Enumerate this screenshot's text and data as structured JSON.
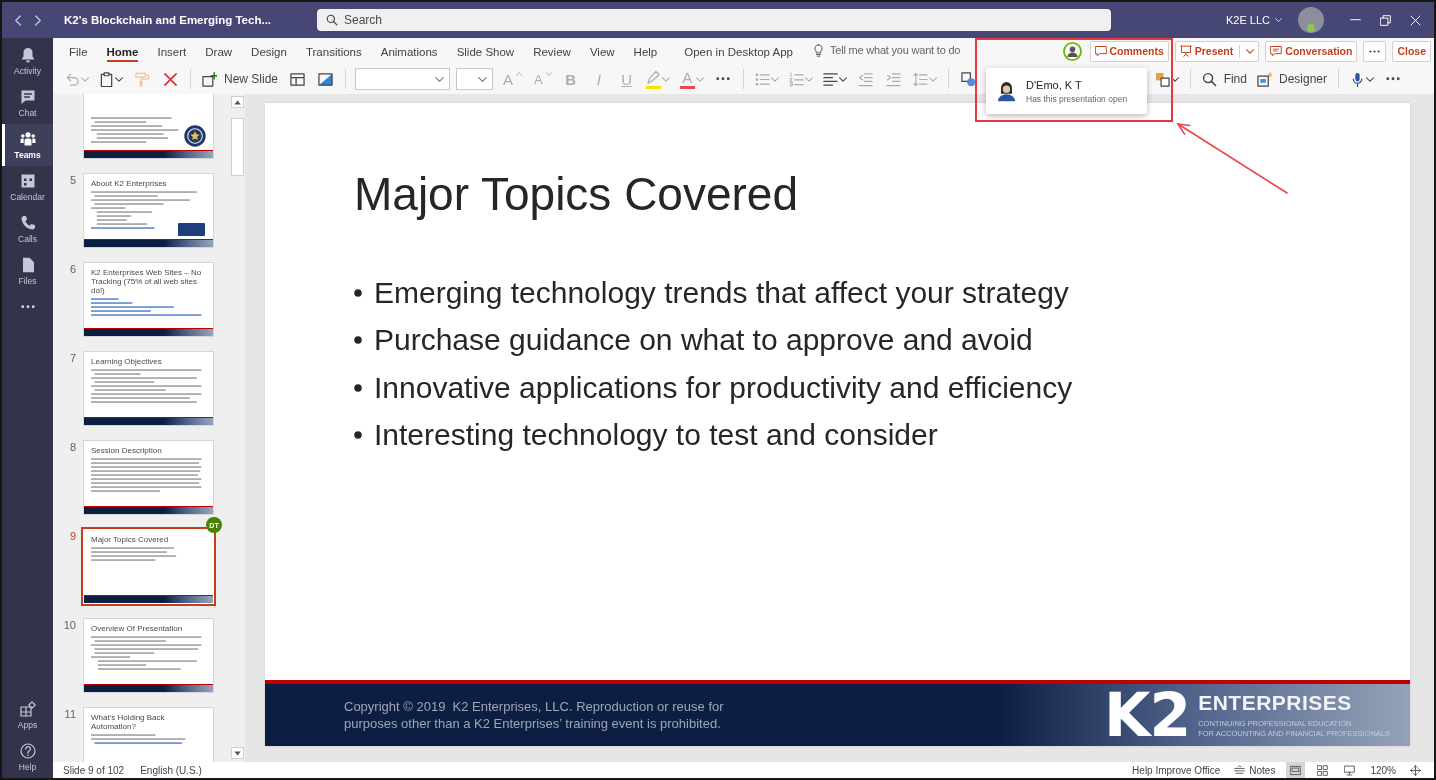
{
  "title_bar": {
    "title": "K2's Blockchain and Emerging Tech...",
    "search": {
      "placeholder": "Search"
    },
    "account": "K2E LLC",
    "online": true
  },
  "app_bar": {
    "items": [
      {
        "label": "Activity",
        "selected": false
      },
      {
        "label": "Chat",
        "selected": false
      },
      {
        "label": "Teams",
        "selected": true
      },
      {
        "label": "Calendar",
        "selected": false
      },
      {
        "label": "Calls",
        "selected": false
      },
      {
        "label": "Files",
        "selected": false
      }
    ],
    "bottom_items": [
      {
        "label": "Apps"
      },
      {
        "label": "Help"
      }
    ]
  },
  "ribbon": {
    "tabs": [
      {
        "label": "File",
        "selected": false
      },
      {
        "label": "Home",
        "selected": true
      },
      {
        "label": "Insert",
        "selected": false
      },
      {
        "label": "Draw",
        "selected": false
      },
      {
        "label": "Design",
        "selected": false
      },
      {
        "label": "Transitions",
        "selected": false
      },
      {
        "label": "Animations",
        "selected": false
      },
      {
        "label": "Slide Show",
        "selected": false
      },
      {
        "label": "Review",
        "selected": false
      },
      {
        "label": "View",
        "selected": false
      },
      {
        "label": "Help",
        "selected": false
      }
    ],
    "open_in_desktop": "Open in Desktop App",
    "tell_me": {
      "placeholder": "Tell me what you want to do"
    },
    "actions": {
      "comments": "Comments",
      "present": "Present",
      "conversation": "Conversation",
      "close": "Close"
    },
    "toolbar": {
      "left": [
        [
          {
            "disabled": true
          },
          {
            "disabled": false
          },
          {
            "disabled": true
          },
          {
            "disabled": false
          }
        ],
        [
          {
            "label": "New Slide",
            "disabled": false
          },
          {
            "disabled": false
          },
          {
            "disabled": false
          }
        ],
        [
          {
            "kind": "field"
          },
          {
            "kind": "field"
          },
          {
            "kind": "button",
            "label": "A",
            "disabled": true
          },
          {
            "kind": "button",
            "label": "A",
            "disabled": true
          },
          {
            "kind": "button",
            "label": "B",
            "disabled": true
          },
          {
            "kind": "button",
            "label": "I",
            "disabled": true
          },
          {
            "kind": "button",
            "label": "U",
            "disabled": true
          },
          {
            "kind": "button",
            "disabled": true,
            "color": "#fce100"
          },
          {
            "kind": "button",
            "label": "A",
            "disabled": true,
            "color": "#e74856"
          },
          {
            "kind": "button",
            "disabled": false
          }
        ],
        [
          {
            "disabled": true
          },
          {
            "disabled": true
          },
          {
            "disabled": false
          },
          {
            "disabled": true
          },
          {
            "disabled": true
          },
          {
            "disabled": true
          }
        ],
        [
          {
            "disabled": false
          }
        ]
      ],
      "right": [
        [
          {
            "disabled": false
          }
        ],
        [
          {
            "label": "Find",
            "disabled": false
          },
          {
            "label": "Designer",
            "disabled": false
          }
        ],
        [
          {
            "disabled": false
          },
          {
            "disabled": false
          }
        ]
      ]
    }
  },
  "presence_popover": {
    "name": "D'Emo, K T",
    "status": "Has this presentation open"
  },
  "thumbnails": [
    {
      "selected": false
    },
    {
      "number": "5",
      "title": "About K2 Enterprises",
      "selected": false
    },
    {
      "number": "6",
      "title": "K2 Enterprises Web Sites – No Tracking (75% of all web sites do!)",
      "selected": false
    },
    {
      "number": "7",
      "title": "Learning Objectives",
      "selected": false
    },
    {
      "number": "8",
      "title": "Session Description",
      "selected": false
    },
    {
      "number": "9",
      "title": "Major Topics Covered",
      "selected": true,
      "badge": "DT"
    },
    {
      "number": "10",
      "title": "Overview Of Presentation",
      "selected": false
    },
    {
      "number": "11",
      "title": "What's Holding Back Automation?",
      "selected": false
    }
  ],
  "slide": {
    "title": "Major Topics Covered",
    "bullets": [
      "Emerging technology trends that affect your strategy",
      "Purchase guidance on what to approve and avoid",
      "Innovative applications for productivity and efficiency",
      "Interesting technology to test and consider"
    ],
    "footer": {
      "copyright": "Copyright © 2019  K2 Enterprises, LLC. Reproduction or reuse for purposes other than a K2 Enterprises’ training event is prohibited.",
      "logo": {
        "mark": "K2",
        "name": "ENTERPRISES",
        "tagline": [
          "CONTINUING PROFESSIONAL EDUCATION",
          "FOR ACCOUNTING AND FINANCIAL PROFESSIONALS"
        ]
      }
    }
  },
  "status_bar": {
    "slide_position": "Slide 9 of 102",
    "language": "English (U.S.)",
    "help": "Help Improve Office",
    "notes": "Notes",
    "views": [
      {
        "selected": true
      },
      {
        "selected": false
      },
      {
        "selected": false
      }
    ],
    "zoom": "120%"
  }
}
